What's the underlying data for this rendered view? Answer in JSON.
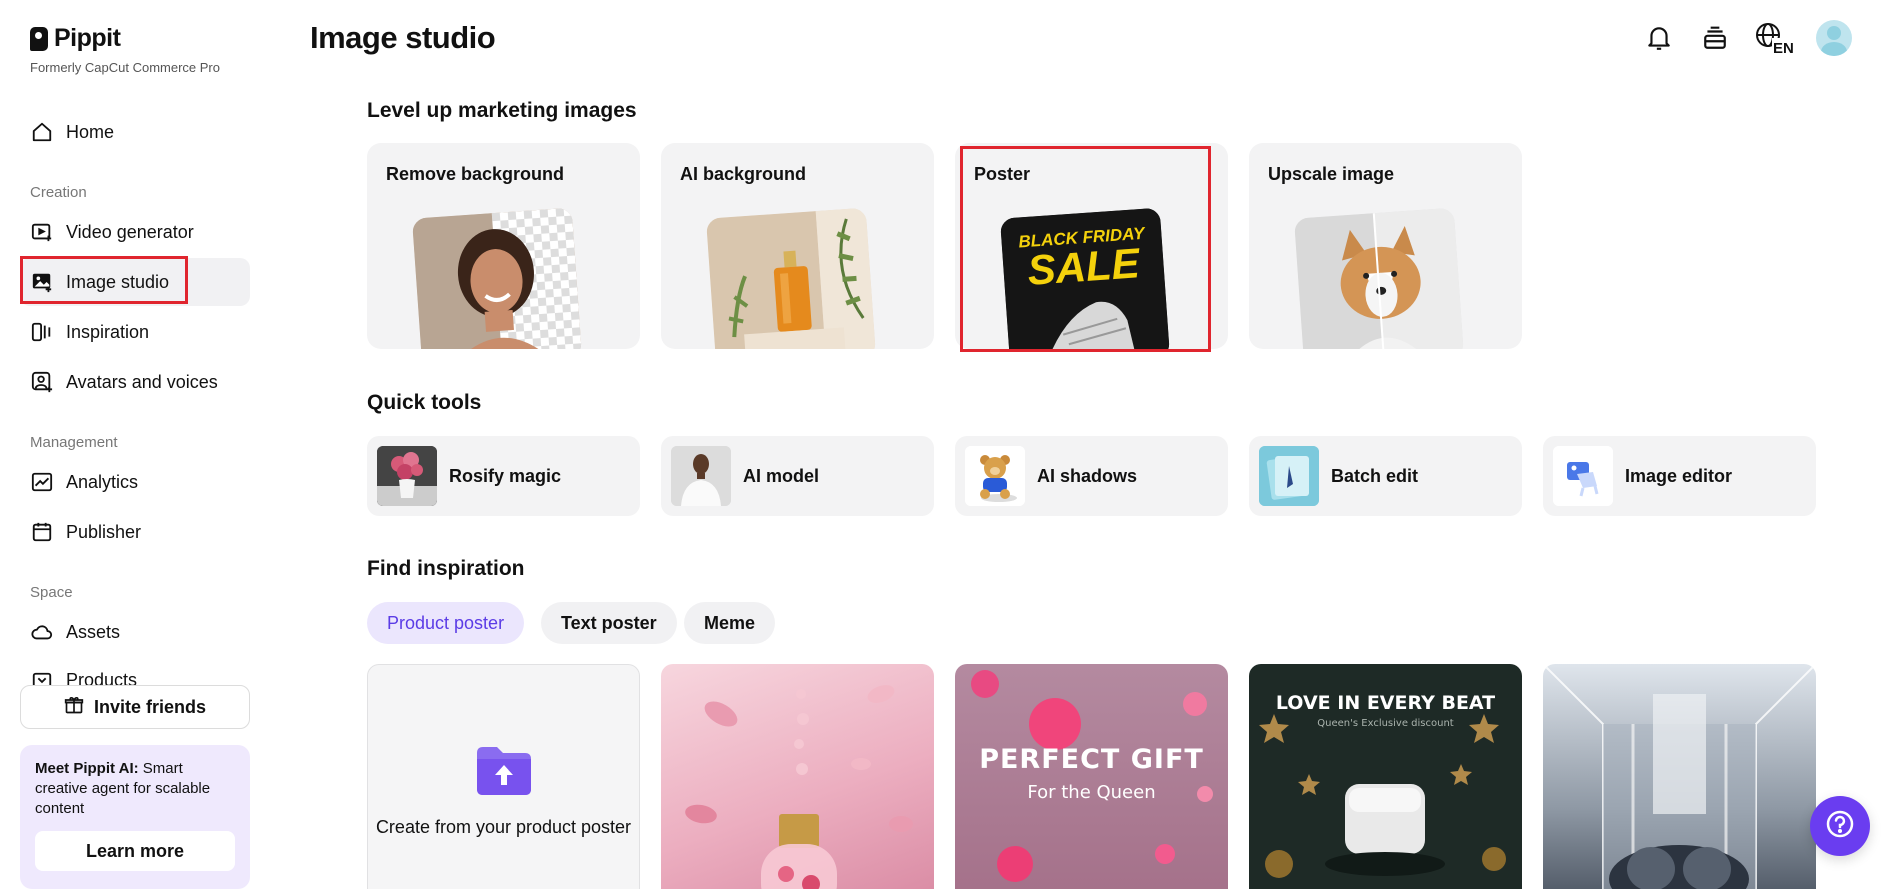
{
  "app": {
    "name": "Pippit",
    "subtitle": "Formerly CapCut Commerce Pro"
  },
  "sidebar": {
    "home": "Home",
    "sections": {
      "creation": "Creation",
      "management": "Management",
      "space": "Space"
    },
    "items": {
      "video_generator": "Video generator",
      "image_studio": "Image studio",
      "inspiration": "Inspiration",
      "avatars": "Avatars and voices",
      "analytics": "Analytics",
      "publisher": "Publisher",
      "assets": "Assets",
      "products": "Products"
    },
    "invite": "Invite friends",
    "promo": {
      "bold": "Meet Pippit AI:",
      "text": " Smart creative agent for scalable content",
      "button": "Learn more"
    }
  },
  "header": {
    "title": "Image studio",
    "language": "EN"
  },
  "marketing": {
    "title": "Level up marketing images",
    "cards": [
      {
        "label": "Remove background"
      },
      {
        "label": "AI background"
      },
      {
        "label": "Poster",
        "poster_line1": "BLACK FRIDAY",
        "poster_line2": "SALE"
      },
      {
        "label": "Upscale image"
      }
    ]
  },
  "quick_tools": {
    "title": "Quick tools",
    "items": [
      {
        "label": "Rosify magic"
      },
      {
        "label": "AI model"
      },
      {
        "label": "AI shadows"
      },
      {
        "label": "Batch edit"
      },
      {
        "label": "Image editor"
      }
    ]
  },
  "inspiration": {
    "title": "Find inspiration",
    "tabs": [
      {
        "label": "Product poster",
        "active": true
      },
      {
        "label": "Text poster",
        "active": false
      },
      {
        "label": "Meme",
        "active": false
      }
    ],
    "create_text": "Create from your product poster",
    "cards": [
      {
        "headline": "",
        "subline": ""
      },
      {
        "headline": "PERFECT GIFT",
        "subline": "For the Queen"
      },
      {
        "headline": "LOVE IN EVERY BEAT",
        "subline": "Queen's Exclusive discount"
      },
      {
        "headline": "",
        "subline": ""
      }
    ]
  },
  "colors": {
    "accent": "#6a3df0",
    "highlight": "#e0252e",
    "chip_active_text": "#5b3ce6"
  }
}
